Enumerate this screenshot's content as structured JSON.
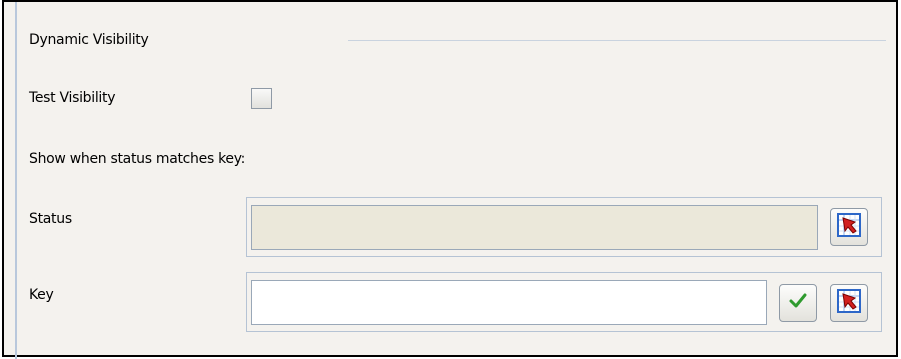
{
  "section": {
    "title": "Dynamic Visibility"
  },
  "test_visibility": {
    "label": "Test Visibility",
    "checked": false
  },
  "instruction": "Show when status matches key:",
  "status": {
    "label": "Status",
    "value": "",
    "picker_icon": "pick-element-icon"
  },
  "key": {
    "label": "Key",
    "value": "",
    "validate_icon": "checkmark-icon",
    "picker_icon": "pick-element-icon"
  },
  "colors": {
    "panel_bg": "#f4f2ee",
    "disabled_field": "#ebe8da",
    "group_border": "#b5c3d4"
  }
}
